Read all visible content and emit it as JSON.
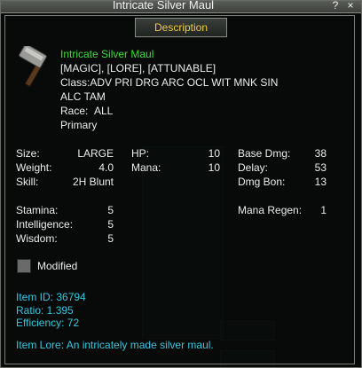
{
  "window": {
    "title": "Intricate Silver Maul",
    "help_label": "?",
    "close_label": "×"
  },
  "tab": {
    "label": "Description"
  },
  "item": {
    "icon": "maul-icon",
    "name": "Intricate Silver Maul",
    "flags": "[MAGIC], [LORE], [ATTUNABLE]",
    "class_line1": "Class:ADV PRI DRG ARC OCL WIT MNK SIN",
    "class_line2": "ALC TAM",
    "race_label": "Race:",
    "race_value": "ALL",
    "slot": "Primary"
  },
  "stats": {
    "size": {
      "label": "Size:",
      "value": "LARGE"
    },
    "weight": {
      "label": "Weight:",
      "value": "4.0"
    },
    "skill": {
      "label": "Skill:",
      "value": "2H Blunt"
    },
    "hp": {
      "label": "HP:",
      "value": "10"
    },
    "mana": {
      "label": "Mana:",
      "value": "10"
    },
    "base_dmg": {
      "label": "Base Dmg:",
      "value": "38"
    },
    "delay": {
      "label": "Delay:",
      "value": "53"
    },
    "dmg_bon": {
      "label": "Dmg Bon:",
      "value": "13"
    },
    "stamina": {
      "label": "Stamina:",
      "value": "5"
    },
    "intelligence": {
      "label": "Intelligence:",
      "value": "5"
    },
    "wisdom": {
      "label": "Wisdom:",
      "value": "5"
    },
    "mana_regen": {
      "label": "Mana Regen:",
      "value": "1"
    }
  },
  "modified": {
    "label": "Modified",
    "checked": true
  },
  "info": {
    "item_id": "Item ID: 36794",
    "ratio": "Ratio: 1.395",
    "efficiency": "Efficiency: 72",
    "lore": "Item Lore: An intricately made silver maul."
  },
  "colors": {
    "name": "#3fdc3a",
    "tab_text": "#f2c84b",
    "info_text": "#37c7e0",
    "text": "#ececec"
  }
}
